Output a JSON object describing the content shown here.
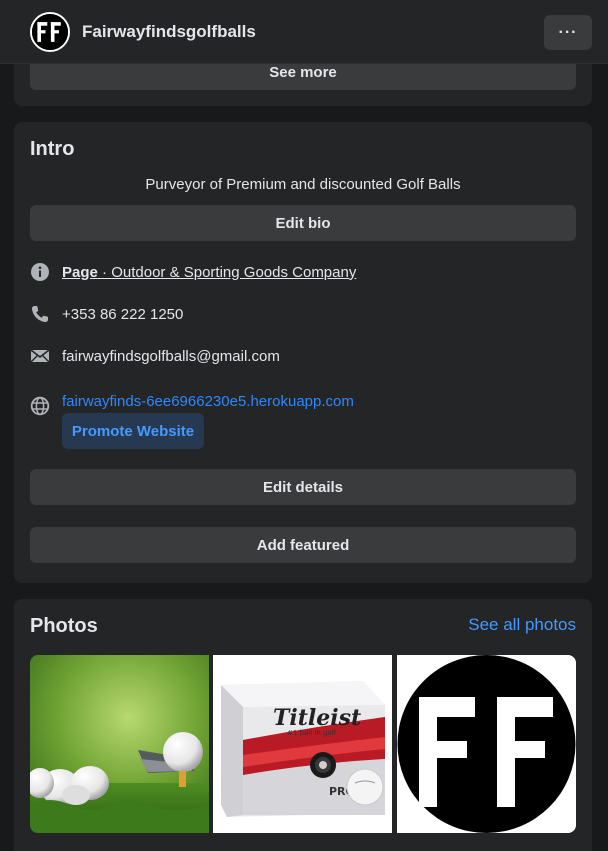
{
  "header": {
    "page_name": "Fairwayfindsgolfballs",
    "avatar_text": "FF",
    "more_label": "···"
  },
  "top_card": {
    "see_more_label": "See more"
  },
  "intro": {
    "title": "Intro",
    "bio": "Purveyor of Premium and discounted Golf Balls",
    "edit_bio_label": "Edit bio",
    "category_prefix": "Page",
    "category_separator": " · ",
    "category": "Outdoor & Sporting Goods Company",
    "phone": "+353 86 222 1250",
    "email": "fairwayfindsgolfballs@gmail.com",
    "website": "fairwayfinds-6ee6966230e5.herokuapp.com",
    "promote_label": "Promote Website",
    "edit_details_label": "Edit details",
    "add_featured_label": "Add featured"
  },
  "photos": {
    "title": "Photos",
    "see_all_label": "See all photos",
    "items": [
      {
        "name": "golf-balls-on-grass-photo"
      },
      {
        "name": "titleist-box-photo",
        "brand": "Titleist",
        "tagline": "#1 ball in golf",
        "model": "PRO"
      },
      {
        "name": "ff-logo-photo",
        "text": "FF"
      }
    ]
  },
  "colors": {
    "background": "#18191a",
    "card": "#242526",
    "button": "#3a3b3c",
    "link": "#2d88ff",
    "promote_bg": "#263951"
  }
}
